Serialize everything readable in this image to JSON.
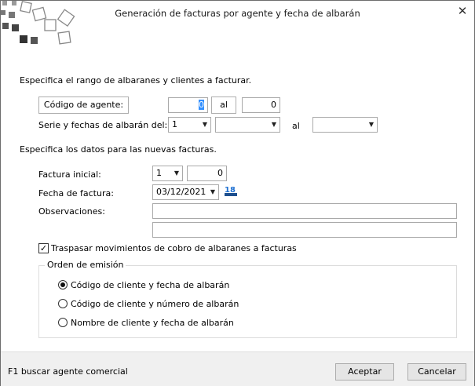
{
  "window": {
    "title": "Generación de facturas por agente y fecha de albarán",
    "close_glyph": "✕"
  },
  "range": {
    "heading": "Especifica el rango de albaranes y clientes a facturar.",
    "agent_button": "Código de agente:",
    "agent_from": "0",
    "al_button": "al",
    "agent_to": "0",
    "serie_label": "Serie y fechas de albarán del:",
    "serie_value": "1",
    "date_from": "",
    "al_label": "al",
    "date_to": ""
  },
  "new_invoices": {
    "heading": "Especifica los datos para las nuevas facturas.",
    "initial_label": "Factura inicial:",
    "initial_serie": "1",
    "initial_number": "0",
    "date_label": "Fecha de factura:",
    "date_value": "03/12/2021",
    "calendar_icon_text": "18",
    "notes_label": "Observaciones:",
    "notes_line1": "",
    "notes_line2": "",
    "transfer_label": "Traspasar movimientos de cobro de albaranes a facturas",
    "transfer_checked": true
  },
  "order": {
    "legend": "Orden de emisión",
    "options": [
      {
        "label": "Código de cliente y fecha de albarán",
        "selected": true
      },
      {
        "label": "Código de cliente y número de albarán",
        "selected": false
      },
      {
        "label": "Nombre de cliente y fecha de albarán",
        "selected": false
      }
    ]
  },
  "footer": {
    "hint": "F1 buscar agente comercial",
    "accept": "Aceptar",
    "cancel": "Cancelar"
  }
}
